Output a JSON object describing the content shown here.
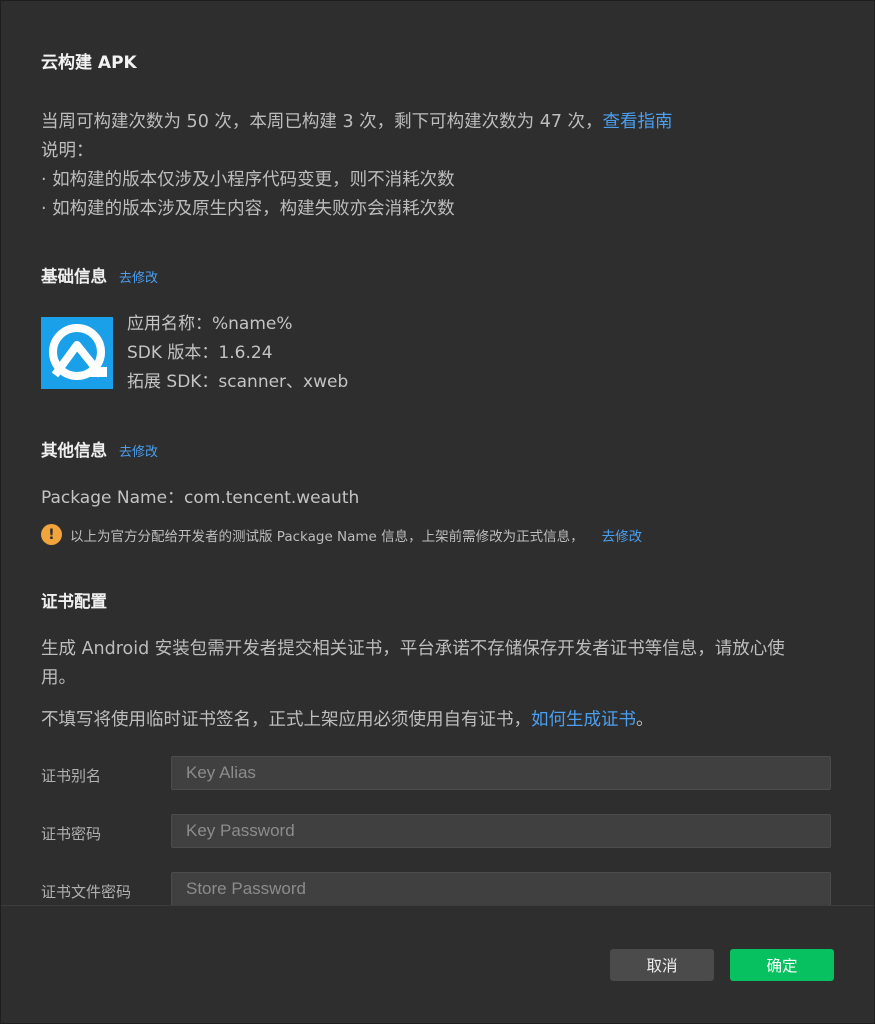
{
  "dialog": {
    "title": "云构建 APK"
  },
  "quota": {
    "line1": "当周可构建次数为 50 次，本周已构建 3 次，剩下可构建次数为 47 次，",
    "guide_link": "查看指南",
    "note_heading": "说明：",
    "note_1": "· 如构建的版本仅涉及小程序代码变更，则不消耗次数",
    "note_2": "· 如构建的版本涉及原生内容，构建失败亦会消耗次数"
  },
  "basic_info": {
    "heading": "基础信息",
    "edit_label": "去修改",
    "app_name": "应用名称：%name%",
    "sdk_version": "SDK 版本：1.6.24",
    "ext_sdk": "拓展 SDK：scanner、xweb",
    "icon": "app-logo-icon"
  },
  "other_info": {
    "heading": "其他信息",
    "edit_label": "去修改",
    "package_name": "Package Name：com.tencent.weauth",
    "warning_text": "以上为官方分配给开发者的测试版 Package Name 信息，上架前需修改为正式信息，",
    "warning_edit": "去修改",
    "warning_icon": "warning-icon",
    "warning_color": "#f0a43b"
  },
  "certificate": {
    "heading": "证书配置",
    "desc_1": "生成 Android 安装包需开发者提交相关证书，平台承诺不存储保存开发者证书等信息，请放心使",
    "desc_1b": "用。",
    "desc_2": "不填写将使用临时证书签名，正式上架应用必须使用自有证书，",
    "desc_2_link": "如何生成证书",
    "desc_2_end": "。",
    "fields": [
      {
        "label": "证书别名",
        "placeholder": "Key Alias",
        "value": ""
      },
      {
        "label": "证书密码",
        "placeholder": "Key Password",
        "value": ""
      },
      {
        "label": "证书文件密码",
        "placeholder": "Store Password",
        "value": ""
      }
    ]
  },
  "footer": {
    "cancel_label": "取消",
    "confirm_label": "确定",
    "confirm_color": "#07c160",
    "link_color": "#4b9ff0"
  }
}
